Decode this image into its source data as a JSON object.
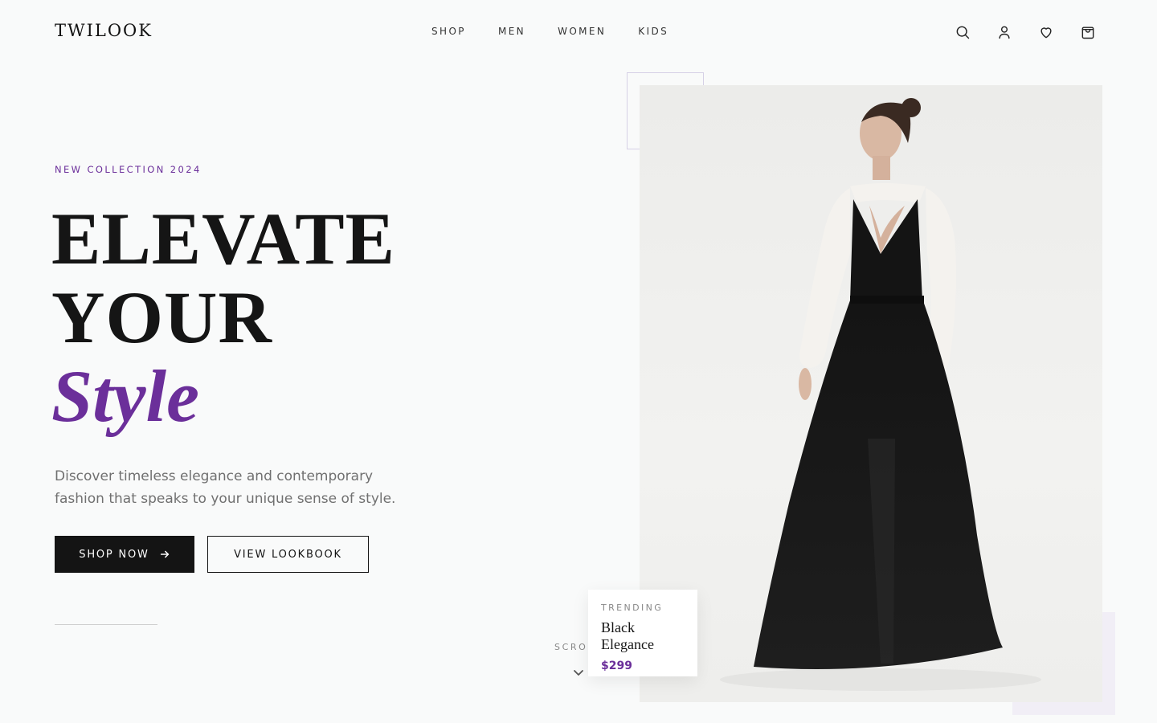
{
  "brand": {
    "name": "TWILOOK"
  },
  "nav": {
    "items": [
      {
        "label": "SHOP"
      },
      {
        "label": "MEN"
      },
      {
        "label": "WOMEN"
      },
      {
        "label": "KIDS"
      }
    ]
  },
  "header_icons": [
    "search-icon",
    "user-icon",
    "heart-icon",
    "bag-icon"
  ],
  "hero": {
    "eyebrow": "NEW COLLECTION 2024",
    "headline_line1": "ELEVATE",
    "headline_line2": "YOUR",
    "headline_accent": "Style",
    "description": "Discover timeless elegance and contemporary fashion that speaks to your unique sense of style.",
    "primary_button": "SHOP NOW",
    "secondary_button": "VIEW LOOKBOOK"
  },
  "scroll": {
    "label": "SCRO"
  },
  "trending": {
    "label": "TRENDING",
    "name": "Black Elegance",
    "price": "$299"
  },
  "colors": {
    "background": "#f9fafa",
    "accent": "#6b2f9a",
    "text_dark": "#151515",
    "text_muted": "#707070",
    "button_dark": "#141414"
  }
}
